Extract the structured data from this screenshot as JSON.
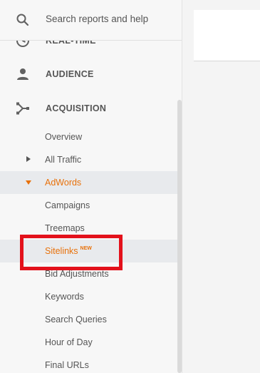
{
  "search": {
    "placeholder": "Search reports and help"
  },
  "sections": {
    "realtime": "REAL-TIME",
    "audience": "AUDIENCE",
    "acquisition": "ACQUISITION"
  },
  "acquisition_items": {
    "overview": "Overview",
    "all_traffic": "All Traffic",
    "adwords": "AdWords",
    "campaigns": "Campaigns",
    "treemaps": "Treemaps",
    "sitelinks": "Sitelinks",
    "sitelinks_badge": "NEW",
    "bid_adjustments": "Bid Adjustments",
    "keywords": "Keywords",
    "search_queries": "Search Queries",
    "hour_of_day": "Hour of Day",
    "final_urls": "Final URLs"
  },
  "colors": {
    "active_accent": "#e8710a",
    "highlight_box": "#e3111b"
  },
  "icons": {
    "search": "search-icon",
    "realtime": "clock-icon",
    "audience": "person-icon",
    "acquisition": "acquisition-icon"
  }
}
